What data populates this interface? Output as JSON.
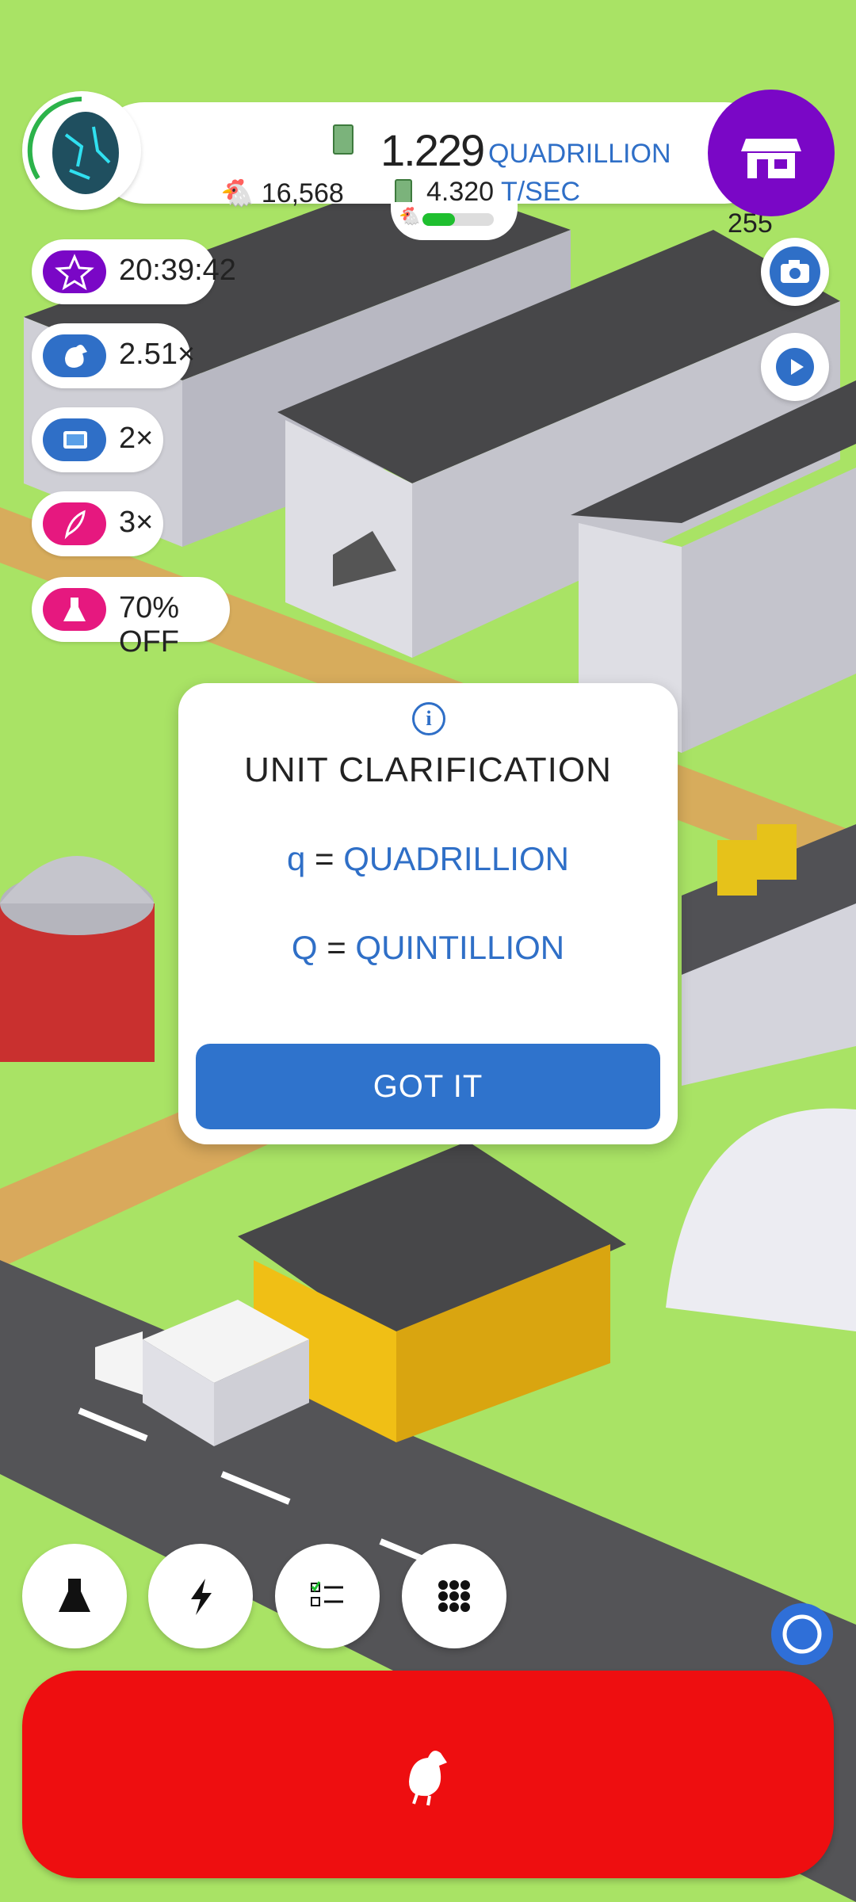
{
  "hud": {
    "population": "16,568",
    "cash_value": "1.229",
    "cash_unit": "QUADRILLION",
    "rate_value": "4.320",
    "rate_unit": "T/SEC",
    "golden_eggs": "255",
    "habitat_progress": 0.45
  },
  "boosts": [
    {
      "label": "20:39:42",
      "icon": "star-icon",
      "color": "#7a07c6"
    },
    {
      "label": "2.51×",
      "icon": "chicken-icon",
      "color": "#2f6fc7"
    },
    {
      "label": "2×",
      "icon": "tv-icon",
      "color": "#2f6fc7"
    },
    {
      "label": "3×",
      "icon": "feather-icon",
      "color": "#e6187f"
    },
    {
      "label": "70% OFF",
      "icon": "flask-icon",
      "color": "#e6187f"
    }
  ],
  "dialog": {
    "title": "UNIT CLARIFICATION",
    "line1_symbol": "q",
    "line1_eq": "=",
    "line1_name": "QUADRILLION",
    "line2_symbol": "Q",
    "line2_eq": "=",
    "line2_name": "QUINTILLION",
    "button": "GOT IT"
  },
  "colors": {
    "accent_blue": "#2f73cc",
    "shop_purple": "#7a07c6",
    "hatch_red": "#ee0e10",
    "grass": "#a9e365"
  },
  "icons": {
    "shop": "shop-icon",
    "camera": "camera-icon",
    "video": "play-icon",
    "research": "flask-icon",
    "boosts": "lightning-icon",
    "missions": "checklist-icon",
    "menu": "grid-icon",
    "hatch": "chicken-icon",
    "assist": "circle-icon"
  }
}
